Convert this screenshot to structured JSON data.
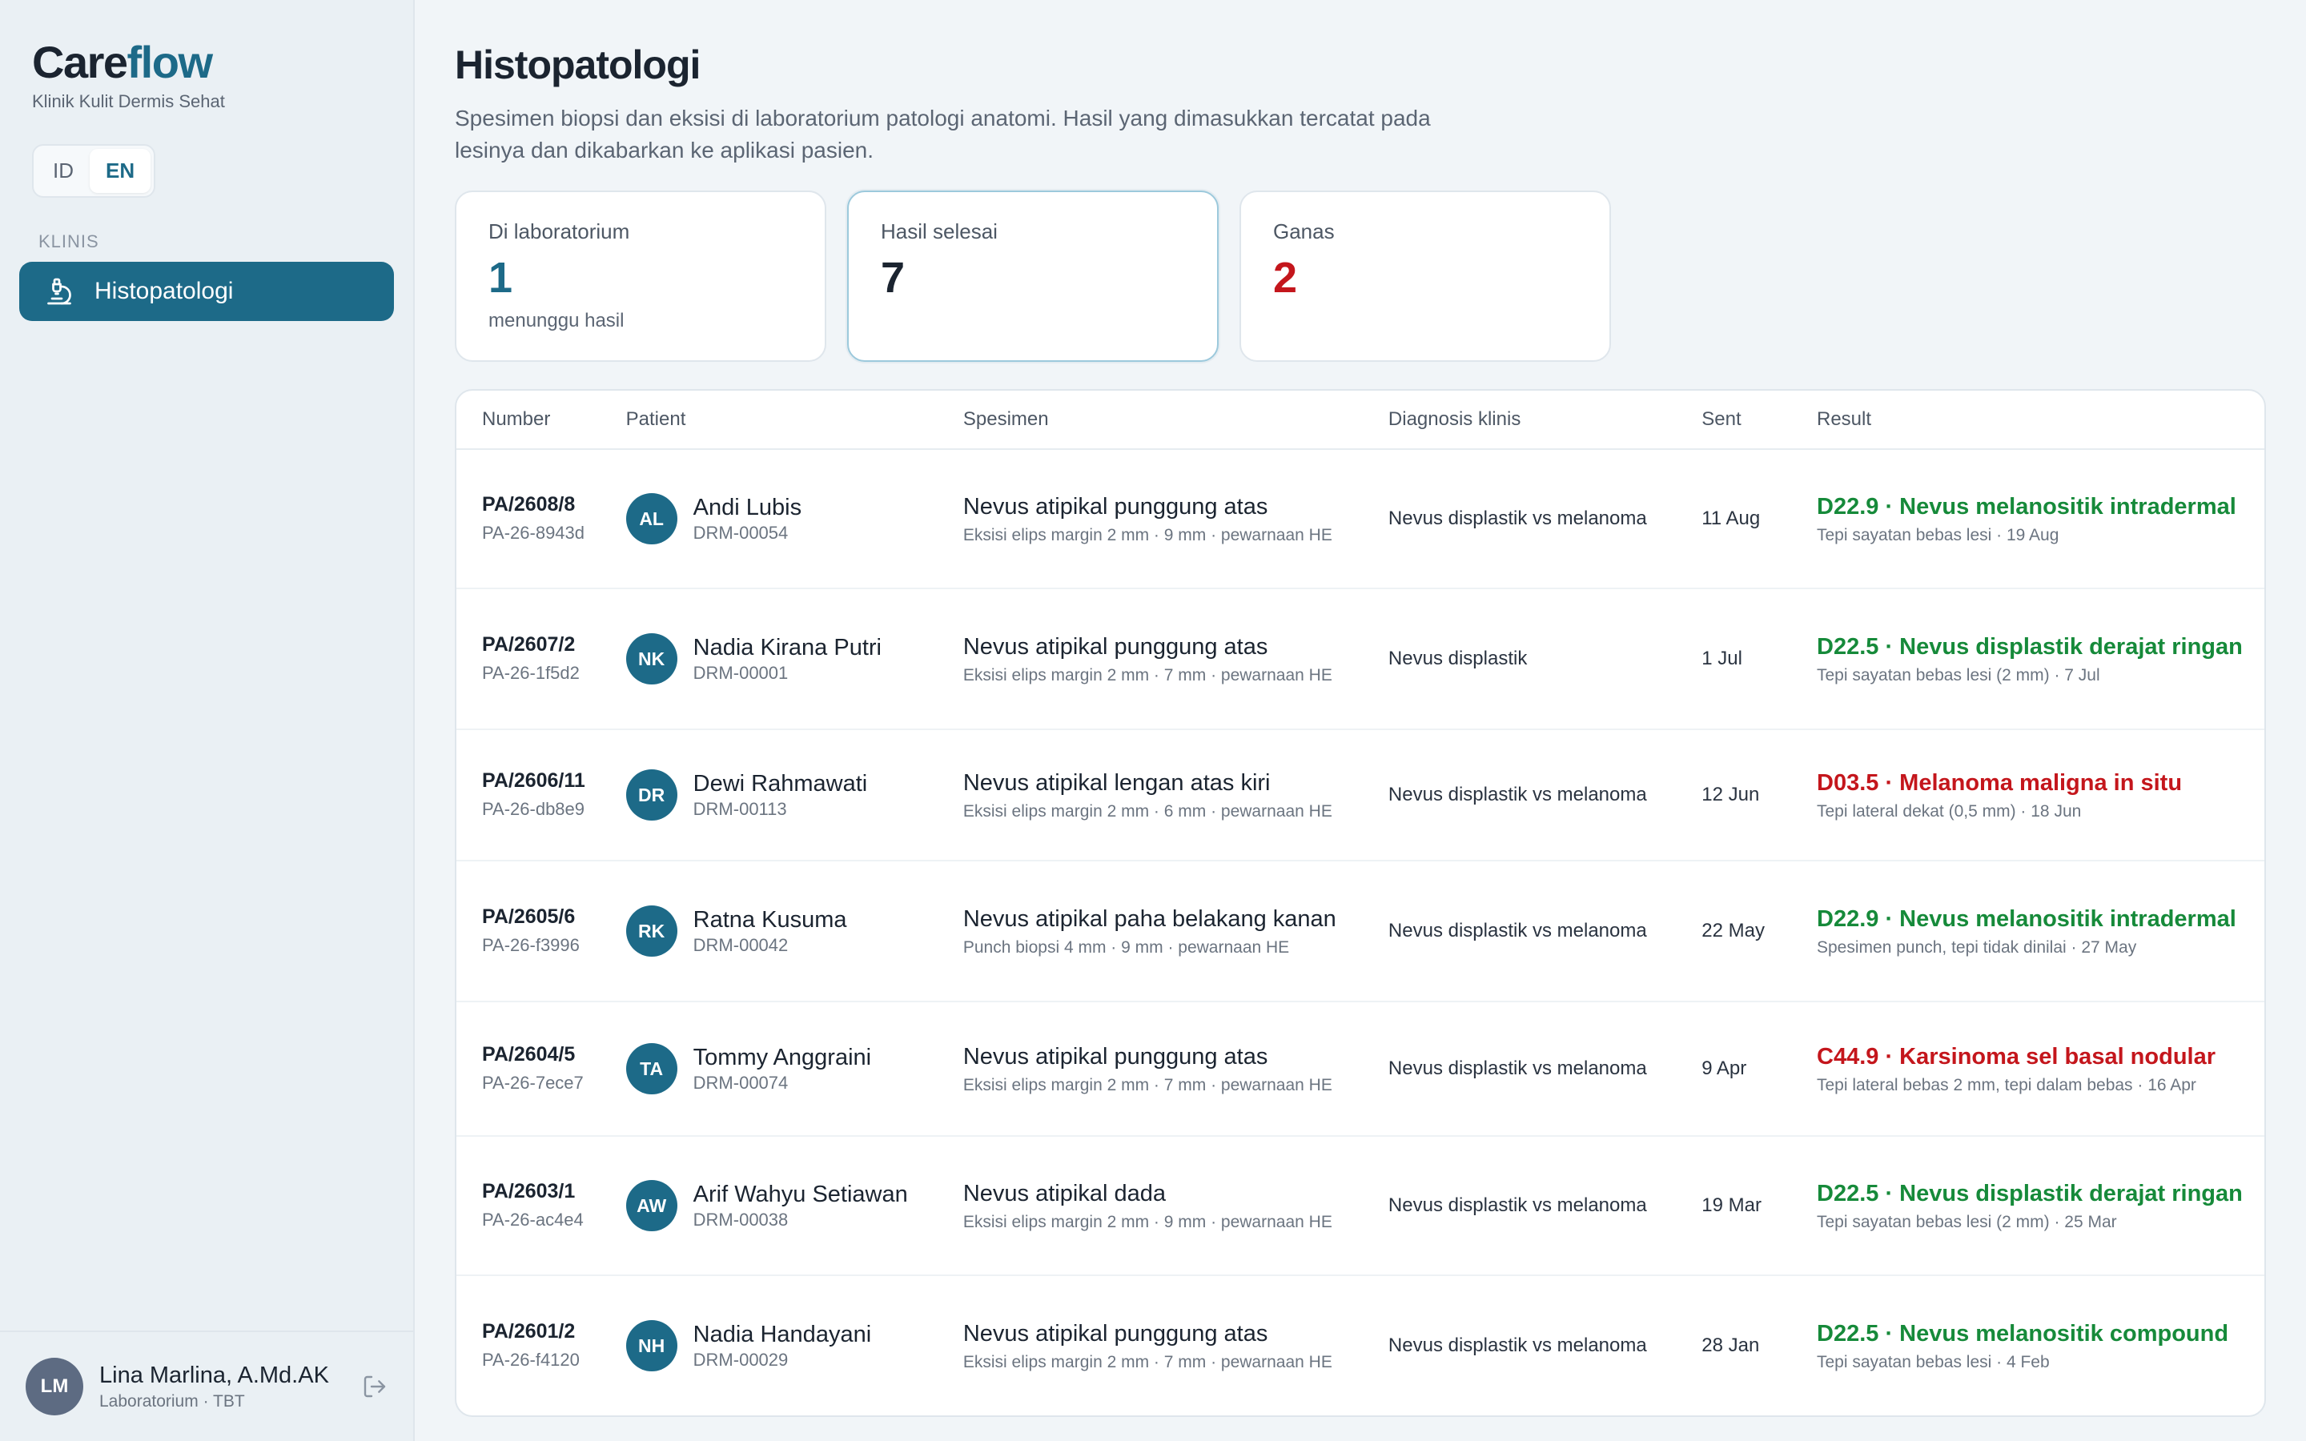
{
  "brand": {
    "part1": "Care",
    "part2": "flow",
    "clinic": "Klinik Kulit Dermis Sehat"
  },
  "lang": {
    "id": "ID",
    "en": "EN",
    "active": "EN"
  },
  "sidebar": {
    "section_label": "KLINIS",
    "items": [
      {
        "label": "Histopatologi",
        "icon": "microscope-icon",
        "active": true
      }
    ]
  },
  "user": {
    "initials": "LM",
    "name": "Lina Marlina, A.Md.AK",
    "role": "Laboratorium · TBT"
  },
  "page": {
    "title": "Histopatologi",
    "description": "Spesimen biopsi dan eksisi di laboratorium patologi anatomi. Hasil yang dimasukkan tercatat pada lesinya dan dikabarkan ke aplikasi pasien."
  },
  "stats": [
    {
      "label": "Di laboratorium",
      "value": "1",
      "sub": "menunggu hasil",
      "color": "#1d6a88"
    },
    {
      "label": "Hasil selesai",
      "value": "7",
      "sub": "",
      "color": "#1b2430"
    },
    {
      "label": "Ganas",
      "value": "2",
      "sub": "",
      "color": "#c4161c"
    }
  ],
  "table": {
    "headers": {
      "number": "Number",
      "patient": "Patient",
      "spesimen": "Spesimen",
      "diagnosis": "Diagnosis klinis",
      "sent": "Sent",
      "result": "Result"
    },
    "rows": [
      {
        "number": "PA/2608/8",
        "uid": "PA-26-8943d",
        "initials": "AL",
        "name": "Andi Lubis",
        "mrn": "DRM-00054",
        "spec": "Nevus atipikal punggung atas",
        "spec_detail": "Eksisi elips margin 2 mm · 9 mm · pewarnaan HE",
        "diagnosis": "Nevus displastik vs melanoma",
        "sent": "11 Aug",
        "result": "D22.9 · Nevus melanositik intradermal",
        "result_detail": "Tepi sayatan bebas lesi · 19 Aug",
        "malignant": false
      },
      {
        "number": "PA/2607/2",
        "uid": "PA-26-1f5d2",
        "initials": "NK",
        "name": "Nadia Kirana Putri",
        "mrn": "DRM-00001",
        "spec": "Nevus atipikal punggung atas",
        "spec_detail": "Eksisi elips margin 2 mm · 7 mm · pewarnaan HE",
        "diagnosis": "Nevus displastik",
        "sent": "1 Jul",
        "result": "D22.5 · Nevus displastik derajat ringan",
        "result_detail": "Tepi sayatan bebas lesi (2 mm) · 7 Jul",
        "malignant": false
      },
      {
        "number": "PA/2606/11",
        "uid": "PA-26-db8e9",
        "initials": "DR",
        "name": "Dewi Rahmawati",
        "mrn": "DRM-00113",
        "spec": "Nevus atipikal lengan atas kiri",
        "spec_detail": "Eksisi elips margin 2 mm · 6 mm · pewarnaan HE",
        "diagnosis": "Nevus displastik vs melanoma",
        "sent": "12 Jun",
        "result": "D03.5 · Melanoma maligna in situ",
        "result_detail": "Tepi lateral dekat (0,5 mm) · 18 Jun",
        "malignant": true
      },
      {
        "number": "PA/2605/6",
        "uid": "PA-26-f3996",
        "initials": "RK",
        "name": "Ratna Kusuma",
        "mrn": "DRM-00042",
        "spec": "Nevus atipikal paha belakang kanan",
        "spec_detail": "Punch biopsi 4 mm · 9 mm · pewarnaan HE",
        "diagnosis": "Nevus displastik vs melanoma",
        "sent": "22 May",
        "result": "D22.9 · Nevus melanositik intradermal",
        "result_detail": "Spesimen punch, tepi tidak dinilai · 27 May",
        "malignant": false
      },
      {
        "number": "PA/2604/5",
        "uid": "PA-26-7ece7",
        "initials": "TA",
        "name": "Tommy Anggraini",
        "mrn": "DRM-00074",
        "spec": "Nevus atipikal punggung atas",
        "spec_detail": "Eksisi elips margin 2 mm · 7 mm · pewarnaan HE",
        "diagnosis": "Nevus displastik vs melanoma",
        "sent": "9 Apr",
        "result": "C44.9 · Karsinoma sel basal nodular",
        "result_detail": "Tepi lateral bebas 2 mm, tepi dalam bebas · 16 Apr",
        "malignant": true
      },
      {
        "number": "PA/2603/1",
        "uid": "PA-26-ac4e4",
        "initials": "AW",
        "name": "Arif Wahyu Setiawan",
        "mrn": "DRM-00038",
        "spec": "Nevus atipikal dada",
        "spec_detail": "Eksisi elips margin 2 mm · 9 mm · pewarnaan HE",
        "diagnosis": "Nevus displastik vs melanoma",
        "sent": "19 Mar",
        "result": "D22.5 · Nevus displastik derajat ringan",
        "result_detail": "Tepi sayatan bebas lesi (2 mm) · 25 Mar",
        "malignant": false
      },
      {
        "number": "PA/2601/2",
        "uid": "PA-26-f4120",
        "initials": "NH",
        "name": "Nadia Handayani",
        "mrn": "DRM-00029",
        "spec": "Nevus atipikal punggung atas",
        "spec_detail": "Eksisi elips margin 2 mm · 7 mm · pewarnaan HE",
        "diagnosis": "Nevus displastik vs melanoma",
        "sent": "28 Jan",
        "result": "D22.5 · Nevus melanositik compound",
        "result_detail": "Tepi sayatan bebas lesi · 4 Feb",
        "malignant": false
      }
    ]
  },
  "colors": {
    "accent": "#1d6a88",
    "benign": "#168a3a",
    "malignant": "#c4161c"
  }
}
